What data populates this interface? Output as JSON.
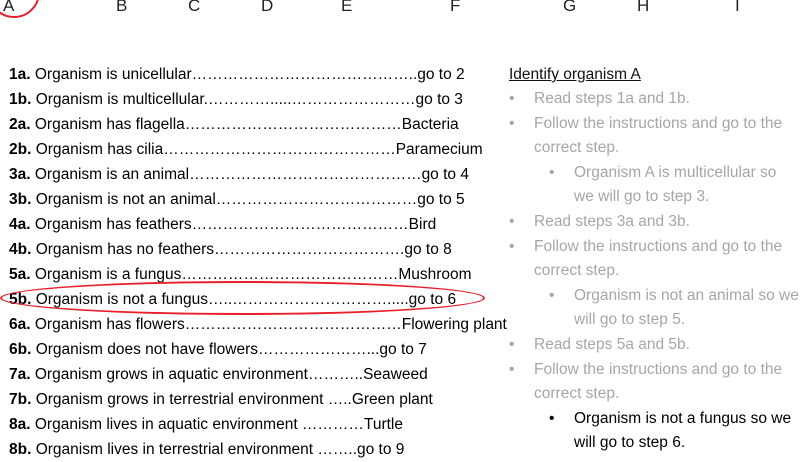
{
  "column_letters": [
    "A",
    "B",
    "C",
    "D",
    "E",
    "F",
    "G",
    "H",
    "I"
  ],
  "key_rows": [
    {
      "id": "1a.",
      "text": " Organism is unicellular……………………………………..go to 2"
    },
    {
      "id": "1b.",
      "text": " Organism is multicellular.………….....……………………go to 3"
    },
    {
      "id": "2a.",
      "text": " Organism has flagella……………………………………Bacteria"
    },
    {
      "id": "2b.",
      "text": " Organism has cilia………………………………………Paramecium"
    },
    {
      "id": "3a.",
      "text": " Organism is an animal………………………………………go to 4"
    },
    {
      "id": "3b.",
      "text": " Organism is not an animal…………………………………go to 5"
    },
    {
      "id": "4a.",
      "text": " Organism has feathers……………………………………Bird"
    },
    {
      "id": "4b.",
      "text": " Organism has no feathers……………………………….go to 8"
    },
    {
      "id": "5a.",
      "text": " Organism is a fungus……………………………………Mushroom"
    },
    {
      "id": "5b.",
      "text": " Organism is not a fungus…..………………………….....go to 6"
    },
    {
      "id": "6a.",
      "text": " Organism has flowers……………………………………Flowering plant"
    },
    {
      "id": "6b.",
      "text": " Organism does not have flowers…………………...go to 7"
    },
    {
      "id": "7a.",
      "text": " Organism grows in aquatic environment………..Seaweed"
    },
    {
      "id": "7b.",
      "text": " Organism grows in terrestrial environment …..Green plant"
    },
    {
      "id": "8a.",
      "text": " Organism lives in aquatic environment …………Turtle"
    },
    {
      "id": "8b.",
      "text": " Organism lives in terrestrial environment ……..go to 9"
    }
  ],
  "notes": {
    "title": "Identify organism A",
    "items": [
      {
        "level": 0,
        "text": "Read steps 1a and 1b."
      },
      {
        "level": 0,
        "text": "Follow the instructions and go to the correct step."
      },
      {
        "level": 1,
        "text": "Organism A is multicellular so we will go to step 3."
      },
      {
        "level": 0,
        "text": "Read steps 3a and 3b."
      },
      {
        "level": 0,
        "text": "Follow the instructions and go to the correct step."
      },
      {
        "level": 1,
        "text": "Organism is not an animal so we will go to step 5."
      },
      {
        "level": 0,
        "text": "Read steps 5a and 5b."
      },
      {
        "level": 0,
        "text": "Follow the instructions and go to the correct step."
      },
      {
        "level": 2,
        "text": "Organism is not a fungus so we will go to step 6."
      }
    ]
  },
  "colors": {
    "highlight": "#e8202a",
    "muted_text": "#a6a6a6"
  }
}
